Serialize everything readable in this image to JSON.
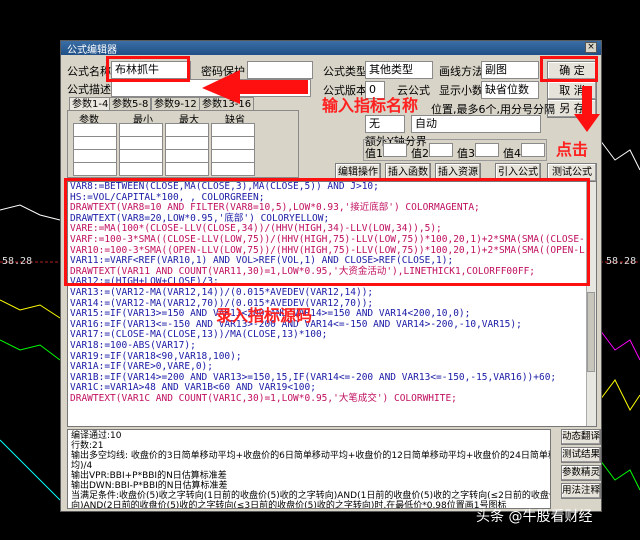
{
  "dialog": {
    "title": "公式编辑器",
    "close_glyph": "×",
    "formula_name_label": "公式名称",
    "formula_name_value": "布林抓牛",
    "password_label": "密码保护",
    "password_value": "",
    "formula_desc_label": "公式描述",
    "formula_desc_value": "",
    "formula_type_label": "公式类型",
    "formula_type_value": "其他类型",
    "draw_method_label": "画线方法",
    "draw_method_value": "副图",
    "formula_version_label": "公式版本",
    "formula_version_value": "0",
    "cloud_formula_label": "云公式",
    "display_decimals_label": "显示小数",
    "display_decimals_value": "缺省位数",
    "ok_button": "确  定",
    "cancel_button": "取  消",
    "save_as_button": "另  存",
    "hint_text": "位置,最多6个,用分号分隔",
    "none_select": "无",
    "auto_select": "自动",
    "extra_axis_label": "额外Y轴分界",
    "value_labels": [
      "值1",
      "值2",
      "值3",
      "值4"
    ],
    "tabs": [
      "参数1-4",
      "参数5-8",
      "参数9-12",
      "参数13-16"
    ],
    "param_headers": [
      "参数",
      "最小",
      "最大",
      "缺省"
    ],
    "toolbar": [
      "编辑操作",
      "插入函数",
      "插入资源",
      "引入公式",
      "测试公式"
    ],
    "side_buttons": [
      "动态翻译",
      "测试结果",
      "参数精灵",
      "用法注释"
    ]
  },
  "code_lines": [
    {
      "text": "VAR8:=BETWEEN(CLOSE,MA(CLOSE,3),MA(CLOSE,5)) AND J>10;",
      "color": "#1a1aa6"
    },
    {
      "text": "HS:=VOL/CAPITAL*100, , COLORGREEN;",
      "color": "#1a1aa6"
    },
    {
      "text": "DRAWTEXT(VAR8=10 AND FILTER(VAR8=10,5),LOW*0.93,'接近底部') COLORMAGENTA;",
      "color": "#c01060"
    },
    {
      "text": "DRAWTEXT(VAR8=20,LOW*0.95,'底部') COLORYELLOW;",
      "color": "#1a1aa6"
    },
    {
      "text": "VARE:=MA(100*(CLOSE-LLV(CLOSE,34))/(HHV(HIGH,34)-LLV(LOW,34)),5);",
      "color": "#c01060"
    },
    {
      "text": "VARF:=100-3*SMA((CLOSE-LLV(LOW,75))/(HHV(HIGH,75)-LLV(LOW,75))*100,20,1)+2*SMA(SMA((CLOSE-",
      "color": "#c01060"
    },
    {
      "text": "VAR10:=100-3*SMA((OPEN-LLV(LOW,75))/(HHV(HIGH,75)-LLV(LOW,75))*100,20,1)+2*SMA(SMA((OPEN-L",
      "color": "#c01060"
    },
    {
      "text": "VAR11:=VARF<REF(VAR10,1) AND VOL>REF(VOL,1) AND CLOSE>REF(CLOSE,1);",
      "color": "#1a1aa6"
    },
    {
      "text": "DRAWTEXT(VAR11 AND COUNT(VAR11,30)=1,LOW*0.95,'大资金活动'),LINETHICK1,COLORFF00FF;",
      "color": "#c01060"
    },
    {
      "text": "VAR12:=(HIGH+LOW+CLOSE)/3;",
      "color": "#1a1aa6"
    },
    {
      "text": "VAR13:=(VAR12-MA(VAR12,14))/(0.015*AVEDEV(VAR12,14));",
      "color": "#1a1aa6"
    },
    {
      "text": "VAR14:=(VAR12-MA(VAR12,70))/(0.015*AVEDEV(VAR12,70));",
      "color": "#1a1aa6"
    },
    {
      "text": "VAR15:=IF(VAR13>=150 AND VAR13<200 AND VAR14>=150 AND VAR14<200,10,0);",
      "color": "#1a1aa6"
    },
    {
      "text": "VAR16:=IF(VAR13<=-150 AND VAR13>-200 AND VAR14<=-150 AND VAR14>-200,-10,VAR15);",
      "color": "#1a1aa6"
    },
    {
      "text": "VAR17:=(CLOSE-MA(CLOSE,13))/MA(CLOSE,13)*100;",
      "color": "#1a1aa6"
    },
    {
      "text": "VAR18:=100-ABS(VAR17);",
      "color": "#1a1aa6"
    },
    {
      "text": "VAR19:=IF(VAR18<90,VAR18,100);",
      "color": "#1a1aa6"
    },
    {
      "text": "VAR1A:=IF(VARE>0,VARE,0);",
      "color": "#1a1aa6"
    },
    {
      "text": "VAR1B:=IF(VAR14>=200 AND VAR13>=150,15,IF(VAR14<=-200 AND VAR13<=-150,-15,VAR16))+60;",
      "color": "#1a1aa6"
    },
    {
      "text": "VAR1C:=VAR1A>48 AND VAR1B<60 AND VAR19<100;",
      "color": "#1a1aa6"
    },
    {
      "text": "DRAWTEXT(VAR1C AND COUNT(VAR1C,30)=1,LOW*0.95,'大笔成交') COLORWHITE;",
      "color": "#c01060"
    }
  ],
  "info_lines": [
    "编译通过:10",
    "行数:21",
    "输出多空均线: 收盘价的3日简单移动平均+收盘价的6日简单移动平均+收盘价的12日简单移动平均+收盘价的24日简单移动平",
    "均)/4",
    "输出VPR:BBI+P*BBI的N日估算标准差",
    "输出DWN:BBI-P*BBI的N日估算标准差",
    "当满足条件:收盘价(5)收之字转向(1日前的收盘价(5)收的之字转向)AND(1日前的收盘价(5)收的之字转向(≤2日前的收盘价(5)收的之字转",
    "向)AND(2日前的收盘价(5)收的之字转向(≤3日前的收盘价(5)收的之字转向)时,在最低价*0.98位置画1号图标"
  ],
  "annotations": {
    "name_hint": "输入指标名称",
    "code_hint": "录入指标源码",
    "click_hint": "点击"
  },
  "background": {
    "price_left": "58.28",
    "price_right": "58.28"
  },
  "watermark": "头条 @牛股看财经",
  "colors": {
    "annotation_red": "#ff1010",
    "title_blue": "#1f4f86",
    "code_blue": "#1a1aa6",
    "code_magenta": "#c01060"
  }
}
